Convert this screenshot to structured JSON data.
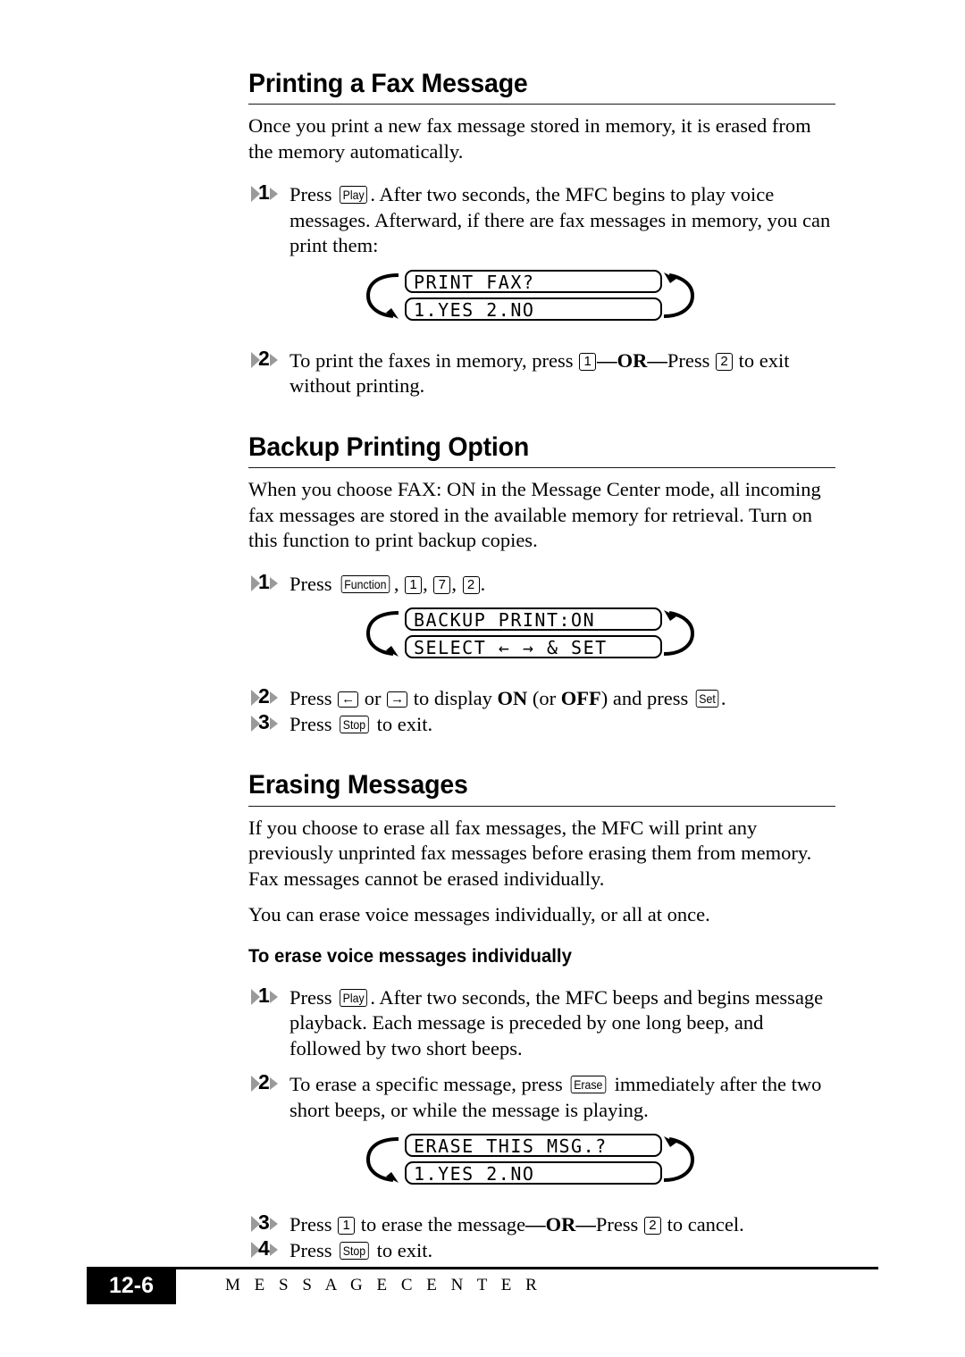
{
  "page": {
    "footer_page_number": "12-6",
    "footer_label": "M E S S A G E   C E N T E R"
  },
  "sections": [
    {
      "id": "printing-a-fax-message",
      "title": "Printing a Fax Message",
      "intro": "Once you print a new fax message stored in memory, it is erased from the memory automatically.",
      "step1_a": "Press ",
      "step1_key": "Play",
      "step1_b": ". After two seconds, the MFC begins to play voice messages. Afterward, if there are fax messages in memory, you can print them:",
      "step1_num": "1",
      "lcd": {
        "line1": "PRINT FAX?",
        "line2": "1.YES 2.NO"
      },
      "step2_num": "2",
      "step2_a": "To print the faxes in memory, press ",
      "step2_key1": "1",
      "step2_or": "—OR—",
      "step2_b": "Press ",
      "step2_key2": "2",
      "step2_c": " to exit without printing."
    },
    {
      "id": "backup-printing-option",
      "title": "Backup Printing Option",
      "intro": "When you choose FAX: ON in the Message Center mode, all incoming fax messages are stored in the available memory for retrieval. Turn on this function to print backup copies.",
      "step1_num": "1",
      "step1_a": "Press ",
      "step1_key1": "Function",
      "step1_sep1": ", ",
      "step1_key2": "1",
      "step1_sep2": ", ",
      "step1_key3": "7",
      "step1_sep3": ", ",
      "step1_key4": "2",
      "step1_end": ".",
      "lcd": {
        "line1": "BACKUP PRINT:ON",
        "line2": "SELECT ← → & SET"
      },
      "step2_num": "2",
      "step2_a": "Press ",
      "step2_keyleft": "←",
      "step2_b": " or ",
      "step2_keyright": "→",
      "step2_c": " to display ",
      "step2_on": "ON",
      "step2_d": " (or ",
      "step2_off": "OFF",
      "step2_e": ") and press ",
      "step2_keyset": "Set",
      "step2_f": ".",
      "step3_num": "3",
      "step3_a": "Press ",
      "step3_key": "Stop",
      "step3_b": " to exit."
    },
    {
      "id": "erasing-messages",
      "title": "Erasing Messages",
      "intro1": "If you choose to erase all fax messages, the MFC will print any previously unprinted fax messages before erasing them from memory. Fax messages cannot be erased individually.",
      "intro2": "You can erase voice messages individually, or all at once.",
      "subtitle": "To erase voice messages individually",
      "step1_num": "1",
      "step1_a": "Press ",
      "step1_key": "Play",
      "step1_b": ". After two seconds, the MFC beeps and begins message playback. Each message is preceded by one long beep, and followed by two short beeps.",
      "step2_num": "2",
      "step2_a": "To erase a specific message, press ",
      "step2_key": "Erase",
      "step2_b": " immediately after the two short beeps, or while the message is playing.",
      "lcd": {
        "line1": "ERASE THIS MSG.?",
        "line2": "1.YES 2.NO"
      },
      "step3_num": "3",
      "step3_a": "Press ",
      "step3_key1": "1",
      "step3_b": " to erase the message",
      "step3_or": "—OR—",
      "step3_c": "Press ",
      "step3_key2": "2",
      "step3_d": " to cancel.",
      "step4_num": "4",
      "step4_a": "Press ",
      "step4_key": "Stop",
      "step4_b": " to exit."
    }
  ]
}
